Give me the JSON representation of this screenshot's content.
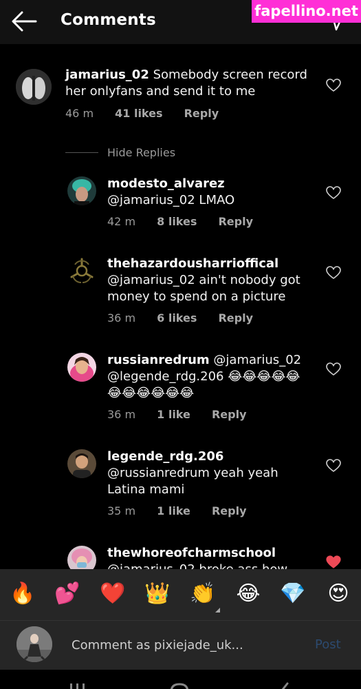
{
  "header": {
    "title": "Comments",
    "watermark": "fapellino.net"
  },
  "comments": [
    {
      "username": "jamarius_02",
      "text": "Somebody screen record her onlyfans and send it to me",
      "time": "46 m",
      "likes": "41 likes",
      "reply": "Reply",
      "liked": false
    },
    {
      "username": "modesto_alvarez",
      "text": "@jamarius_02 LMAO",
      "time": "42 m",
      "likes": "8 likes",
      "reply": "Reply",
      "liked": false
    },
    {
      "username": "thehazardousharrioffical",
      "text": "@jamarius_02 ain't nobody got money to spend on a picture",
      "time": "36 m",
      "likes": "6 likes",
      "reply": "Reply",
      "liked": false
    },
    {
      "username": "russianredrum",
      "text": "@jamarius_02 @legende_rdg.206 😂😂😂😂😂😂😂😂😂😂😂",
      "time": "36 m",
      "likes": "1 like",
      "reply": "Reply",
      "liked": false
    },
    {
      "username": "legende_rdg.206",
      "text": "@russianredrum yeah yeah Latina mami",
      "time": "35 m",
      "likes": "1 like",
      "reply": "Reply",
      "liked": false
    },
    {
      "username": "thewhoreofcharmschool",
      "text": "@jamarius_02 broke ass how",
      "liked": true
    }
  ],
  "hide_replies": "Hide Replies",
  "emoji_bar": [
    "🔥",
    "💕",
    "❤️",
    "👑",
    "👏",
    "😂",
    "💎",
    "😍"
  ],
  "composer": {
    "placeholder": "Comment as pixiejade_uk...",
    "post_label": "Post"
  },
  "colors": {
    "background": "#000000",
    "header": "#121212",
    "panel": "#262626",
    "secondary_text": "#9a9a9a",
    "liked_heart": "#ed4956",
    "post_disabled": "#2c4a6f",
    "watermark": "#ff2fd6"
  }
}
